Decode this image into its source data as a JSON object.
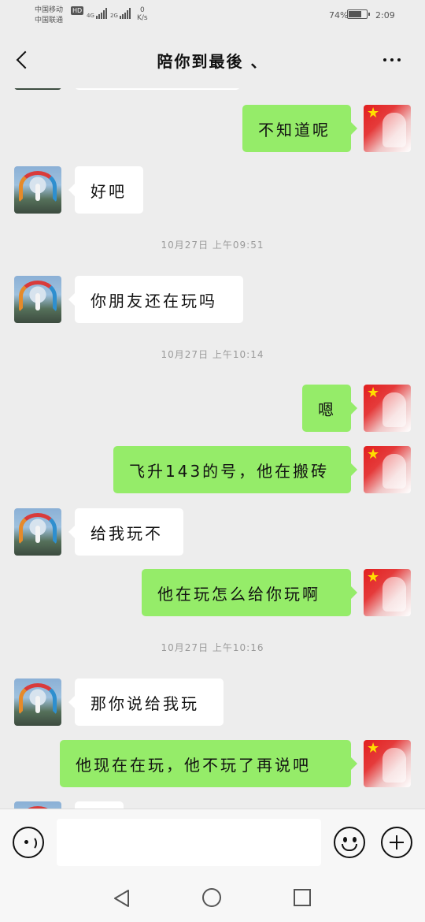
{
  "status_bar": {
    "carrier_1": "中国移动",
    "carrier_2": "中国联通",
    "hd_badge": "HD",
    "signal_1_label": "4G",
    "signal_2_label": "2G",
    "net_speed_value": "0",
    "net_speed_unit": "K/s",
    "battery_percent": "74%",
    "battery_level": 0.74,
    "time": "2:09"
  },
  "header": {
    "title": "陪你到最後 、",
    "back_icon": "chevron-left-icon",
    "more_icon": "more-horizontal-icon"
  },
  "chat": {
    "messages": [
      {
        "sender": "me",
        "text": "不知道呢"
      },
      {
        "sender": "peer",
        "text": "好吧"
      },
      {
        "type": "timestamp",
        "text": "10月27日 上午09:51"
      },
      {
        "sender": "peer",
        "text": "你朋友还在玩吗"
      },
      {
        "type": "timestamp",
        "text": "10月27日 上午10:14"
      },
      {
        "sender": "me",
        "text": "嗯"
      },
      {
        "sender": "me",
        "text": "飞升143的号，他在搬砖"
      },
      {
        "sender": "peer",
        "text": "给我玩不"
      },
      {
        "sender": "me",
        "text": "他在玩怎么给你玩啊"
      },
      {
        "type": "timestamp",
        "text": "10月27日 上午10:16"
      },
      {
        "sender": "peer",
        "text": "那你说给我玩"
      },
      {
        "sender": "me",
        "text": "他现在在玩，他不玩了再说吧"
      }
    ]
  },
  "input_bar": {
    "voice_icon": "voice-icon",
    "input_value": "",
    "emoji_icon": "emoji-icon",
    "plus_icon": "plus-icon"
  },
  "nav_bar": {
    "back_icon": "nav-back-icon",
    "home_icon": "nav-home-icon",
    "recent_icon": "nav-recent-icon"
  },
  "colors": {
    "background": "#ededed",
    "my_bubble": "#95ec69",
    "peer_bubble": "#ffffff",
    "timestamp_text": "#9a9a9a"
  }
}
